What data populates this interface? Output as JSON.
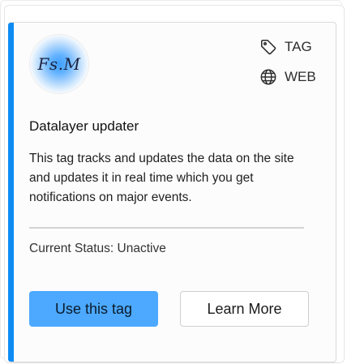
{
  "card": {
    "logo_text": "Fs.M",
    "type_label": "TAG",
    "type_icon": "tag-icon",
    "platform_label": "WEB",
    "platform_icon": "globe-icon",
    "title": "Datalayer updater",
    "description": "This tag tracks and updates the data on the site and updates it in real time which you get notifications on major events.",
    "status": "Current Status: Unactive",
    "primary_button": "Use this tag",
    "secondary_button": "Learn More"
  },
  "colors": {
    "accent": "#0d8bf2",
    "primary_button_bg": "#4ca9ff"
  }
}
